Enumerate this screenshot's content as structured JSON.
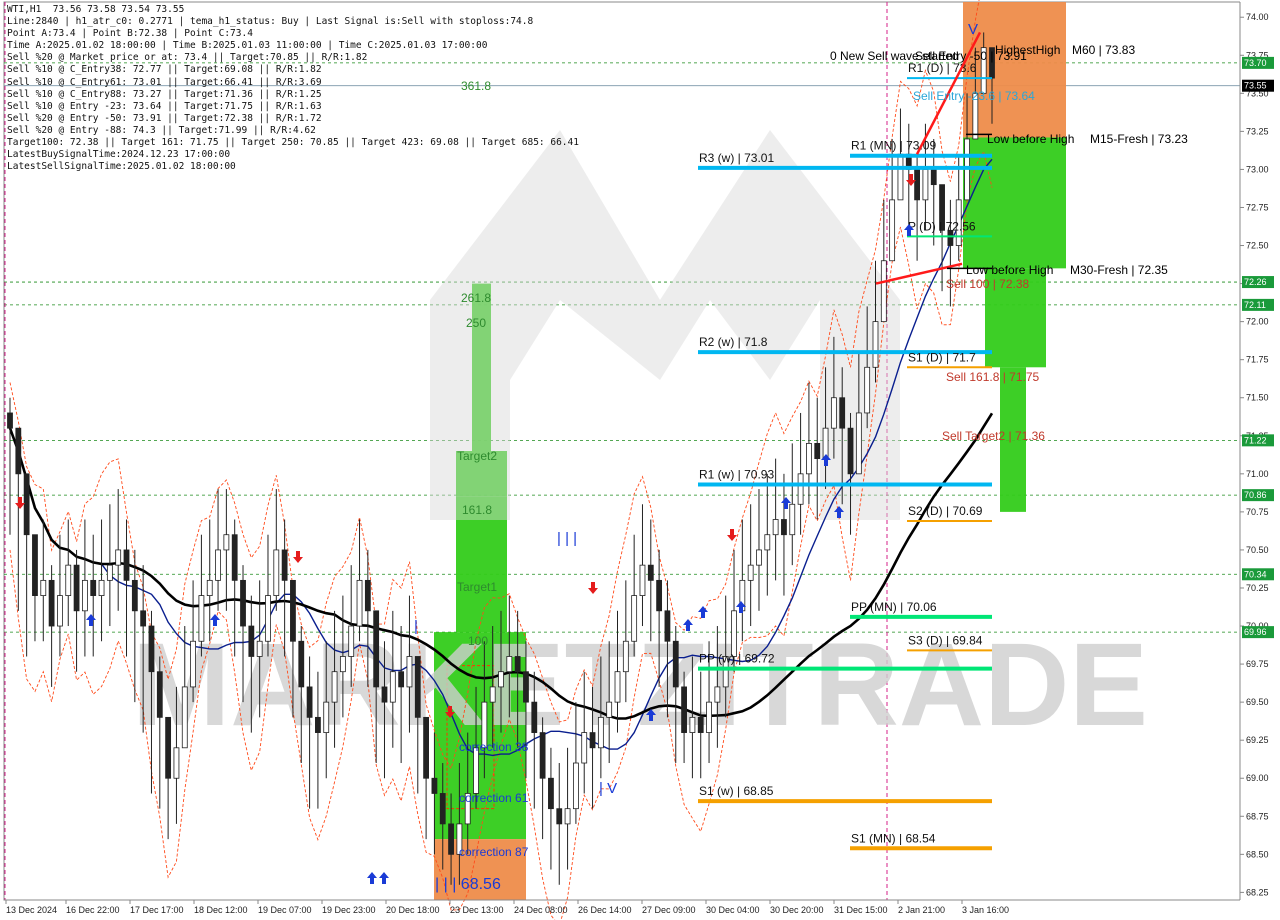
{
  "header": {
    "info_lines": [
      "WTI,H1  73.56 73.58 73.54 73.55",
      "Line:2840 | h1_atr_c0: 0.2771 | tema_h1_status: Buy | Last Signal is:Sell with stoploss:74.8",
      "Point A:73.4 | Point B:72.38 | Point C:73.4",
      "Time A:2025.01.02 18:00:00 | Time B:2025.01.03 11:00:00 | Time C:2025.01.03 17:00:00",
      "Sell %20 @ Market price or at: 73.4 || Target:70.85 || R/R:1.82",
      "Sell %10 @ C_Entry38: 72.77 || Target:69.08 || R/R:1.82",
      "Sell %10 @ C_Entry61: 73.01 || Target:66.41 || R/R:3.69",
      "Sell %10 @ C_Entry88: 73.27 || Target:71.36 || R/R:1.25",
      "Sell %10 @ Entry -23: 73.64 || Target:71.75 || R/R:1.63",
      "Sell %20 @ Entry -50: 73.91 || Target:72.38 || R/R:1.72",
      "Sell %20 @ Entry -88: 74.3 || Target:71.99 || R/R:4.62",
      "Target100: 72.38 || Target 161: 71.75 || Target 250: 70.85 || Target 423: 69.08 || Target 685: 66.41",
      "LatestBuySignalTime:2024.12.23 17:00:00",
      "LatestSellSignalTime:2025.01.02 18:00:00"
    ]
  },
  "watermark": "MARKETZITRADE",
  "colors": {
    "up": "#2e7d32",
    "down": "#8b1a1a",
    "candle_body_up": "#2e7d32",
    "ma_blue": "#0a1f8f",
    "ma_black": "#000000",
    "level_blue": "#00b7f1",
    "level_orange": "#f5a000",
    "level_green": "#00e676",
    "zone_green": "#33cc1a",
    "zone_orange": "#ee8c4a",
    "price_tag_green": "#1a9a3a",
    "grid_dash": "#1a8a1a"
  },
  "chart_data": {
    "type": "candlestick",
    "symbol": "WTI,H1",
    "ylim": [
      68.2,
      74.1
    ],
    "last_price": 73.55,
    "y_ticks": [
      74.0,
      73.75,
      73.5,
      73.25,
      73.0,
      72.75,
      72.5,
      72.25,
      72.0,
      71.75,
      71.5,
      71.25,
      71.0,
      70.75,
      70.5,
      70.25,
      70.0,
      69.75,
      69.5,
      69.25,
      69.0,
      68.75,
      68.5,
      68.25
    ],
    "y_tick_labels": [
      "74.00",
      "73.75",
      "73.50",
      "73.25",
      "73.00",
      "72.75",
      "72.50",
      "72.25",
      "72.00",
      "71.75",
      "71.50",
      "71.25",
      "71.00",
      "70.75",
      "70.50",
      "70.25",
      "70.00",
      "69.75",
      "69.50",
      "69.25",
      "69.00",
      "68.75",
      "68.50",
      "68.25"
    ],
    "highlighted_prices": [
      {
        "value": 73.7,
        "label": "73.70"
      },
      {
        "value": 72.26,
        "label": "72.26"
      },
      {
        "value": 72.11,
        "label": "72.11"
      },
      {
        "value": 71.22,
        "label": "71.22"
      },
      {
        "value": 70.86,
        "label": "70.86"
      },
      {
        "value": 70.34,
        "label": "70.34"
      },
      {
        "value": 69.96,
        "label": "69.96"
      }
    ],
    "x_labels": [
      "13 Dec 2024",
      "16 Dec 22:00",
      "17 Dec 17:00",
      "18 Dec 12:00",
      "19 Dec 07:00",
      "19 Dec 23:00",
      "20 Dec 18:00",
      "23 Dec 13:00",
      "24 Dec 08:00",
      "26 Dec 14:00",
      "27 Dec 09:00",
      "30 Dec 04:00",
      "30 Dec 20:00",
      "31 Dec 15:00",
      "2 Jan 21:00",
      "3 Jan 16:00"
    ],
    "closes": [
      71.3,
      71.0,
      70.6,
      70.2,
      70.3,
      70.0,
      70.2,
      70.4,
      70.1,
      70.3,
      70.2,
      70.3,
      70.4,
      70.5,
      70.3,
      70.1,
      70.0,
      69.7,
      69.4,
      69.0,
      69.2,
      69.6,
      69.9,
      70.2,
      70.3,
      70.5,
      70.6,
      70.3,
      70.0,
      69.8,
      69.9,
      70.2,
      70.5,
      70.3,
      69.9,
      69.6,
      69.4,
      69.3,
      69.5,
      69.7,
      69.8,
      70.0,
      70.3,
      70.1,
      69.6,
      69.5,
      69.7,
      69.6,
      69.8,
      69.4,
      69.0,
      68.9,
      68.7,
      68.5,
      68.7,
      68.9,
      69.2,
      69.5,
      69.6,
      69.7,
      69.8,
      69.7,
      69.5,
      69.3,
      69.0,
      68.8,
      68.7,
      68.8,
      69.1,
      69.3,
      69.2,
      69.4,
      69.5,
      69.7,
      69.9,
      70.2,
      70.4,
      70.3,
      70.1,
      69.9,
      69.6,
      69.3,
      69.4,
      69.3,
      69.5,
      69.6,
      69.8,
      70.1,
      70.3,
      70.4,
      70.5,
      70.6,
      70.7,
      70.6,
      70.8,
      71.0,
      71.2,
      71.1,
      71.3,
      71.5,
      71.3,
      71.0,
      71.4,
      71.7,
      72.0,
      72.4,
      72.8,
      73.1,
      73.0,
      72.8,
      73.0,
      72.9,
      72.6,
      72.5,
      72.8,
      73.2,
      73.5,
      73.8,
      73.6
    ],
    "lows": [
      70.6,
      70.1,
      69.8,
      69.9,
      69.9,
      69.6,
      69.8,
      70.0,
      69.7,
      69.8,
      69.8,
      69.9,
      70.0,
      70.1,
      69.8,
      69.5,
      69.3,
      68.9,
      68.8,
      68.6,
      68.7,
      69.2,
      69.5,
      69.8,
      69.9,
      70.1,
      70.1,
      69.8,
      69.5,
      69.3,
      69.4,
      69.8,
      70.1,
      69.8,
      69.4,
      69.1,
      68.8,
      68.8,
      69.0,
      69.2,
      69.4,
      69.6,
      69.9,
      69.6,
      69.1,
      69.0,
      69.2,
      69.1,
      69.3,
      68.9,
      68.6,
      68.5,
      68.4,
      68.3,
      68.3,
      68.5,
      68.8,
      69.0,
      69.2,
      69.3,
      69.4,
      69.2,
      69.0,
      68.8,
      68.6,
      68.4,
      68.3,
      68.4,
      68.7,
      68.9,
      68.8,
      69.0,
      69.1,
      69.3,
      69.5,
      69.8,
      70.0,
      69.9,
      69.6,
      69.4,
      69.1,
      69.1,
      69.0,
      69.0,
      69.1,
      69.2,
      69.4,
      69.7,
      69.9,
      70.0,
      70.1,
      70.2,
      70.3,
      70.2,
      70.4,
      70.6,
      70.8,
      70.7,
      70.9,
      71.1,
      70.8,
      70.6,
      71.0,
      71.3,
      71.6,
      72.0,
      72.4,
      72.8,
      72.6,
      72.4,
      72.6,
      72.5,
      72.2,
      72.1,
      72.4,
      72.9,
      73.2,
      73.5,
      73.3
    ],
    "highs": [
      71.5,
      71.3,
      70.9,
      70.6,
      70.7,
      70.4,
      70.6,
      70.7,
      70.5,
      70.7,
      70.6,
      70.7,
      70.8,
      70.9,
      70.7,
      70.5,
      70.4,
      70.1,
      69.8,
      69.4,
      69.6,
      70.0,
      70.3,
      70.6,
      70.7,
      70.9,
      70.9,
      70.7,
      70.4,
      70.2,
      70.3,
      70.6,
      70.9,
      70.7,
      70.3,
      70.0,
      69.8,
      69.7,
      69.9,
      70.1,
      70.2,
      70.4,
      70.7,
      70.5,
      70.0,
      69.9,
      70.1,
      70.0,
      70.2,
      69.8,
      69.4,
      69.3,
      69.1,
      68.9,
      69.1,
      69.3,
      69.6,
      69.9,
      70.0,
      70.1,
      70.2,
      70.1,
      69.9,
      69.7,
      69.4,
      69.2,
      69.1,
      69.2,
      69.5,
      69.7,
      69.6,
      69.8,
      69.9,
      70.1,
      70.3,
      70.6,
      70.8,
      70.7,
      70.5,
      70.3,
      70.0,
      69.7,
      69.8,
      69.7,
      69.9,
      70.0,
      70.2,
      70.5,
      70.7,
      70.8,
      70.9,
      71.0,
      71.1,
      71.0,
      71.2,
      71.4,
      71.6,
      71.5,
      71.7,
      71.9,
      71.7,
      71.4,
      71.8,
      72.1,
      72.4,
      72.8,
      73.2,
      73.4,
      73.3,
      73.1,
      73.3,
      73.2,
      72.9,
      72.8,
      73.1,
      73.5,
      73.8,
      73.9,
      73.8
    ],
    "levels": [
      {
        "label": "R3 (w) | 73.01",
        "value": 73.01,
        "color": "#00b7f1"
      },
      {
        "label": "R2 (w) | 71.8",
        "value": 71.8,
        "color": "#00b7f1"
      },
      {
        "label": "R1 (w) | 70.93",
        "value": 70.93,
        "color": "#00b7f1"
      },
      {
        "label": "PP (w) | 69.72",
        "value": 69.72,
        "color": "#00e676"
      },
      {
        "label": "S1 (w) | 68.85",
        "value": 68.85,
        "color": "#f5a000"
      },
      {
        "label": "PP (MN) | 70.06",
        "value": 70.06,
        "color": "#00e676"
      },
      {
        "label": "S1 (MN) | 68.54",
        "value": 68.54,
        "color": "#f5a000"
      },
      {
        "label": "R1 (MN) | 73.09",
        "value": 73.09,
        "color": "#00b7f1"
      },
      {
        "label": "R1 (D) | 73.6",
        "value": 73.6,
        "color": "#00b7f1"
      },
      {
        "label": "P (D) | 72.56",
        "value": 72.56,
        "color": "#00e676"
      },
      {
        "label": "S1 (D) | 71.7",
        "value": 71.7,
        "color": "#f5a000"
      },
      {
        "label": "S2 (D) | 70.69",
        "value": 70.69,
        "color": "#f5a000"
      },
      {
        "label": "S3 (D) | 69.84",
        "value": 69.84,
        "color": "#f5a000"
      }
    ],
    "annotations": [
      {
        "text": "0 New Sell wave started",
        "color": "#000000"
      },
      {
        "text": "Sell Entry -50 | 73.91",
        "color": "#000000"
      },
      {
        "text": "HighestHigh",
        "color": "#000000"
      },
      {
        "text": "M60 | 73.83",
        "color": "#000000"
      },
      {
        "text": "Sell Entry -23.6 | 73.64",
        "color": "#2aa6d8"
      },
      {
        "text": "Low before High",
        "color": "#000000"
      },
      {
        "text": "M15-Fresh | 73.23",
        "color": "#000000"
      },
      {
        "text": "M30-Fresh | 72.35",
        "color": "#000000"
      },
      {
        "text": "Sell 100 | 72.38",
        "color": "#c0392b"
      },
      {
        "text": "Sell 161.8 | 71.75",
        "color": "#c0392b"
      },
      {
        "text": "Sell Target2 | 71.36",
        "color": "#c0392b"
      },
      {
        "text": "361.8",
        "color": "#2e8b2e"
      },
      {
        "text": "261.8",
        "color": "#2e8b2e"
      },
      {
        "text": "250",
        "color": "#2e8b2e"
      },
      {
        "text": "Target2",
        "color": "#2e8b2e"
      },
      {
        "text": "161.8",
        "color": "#2e8b2e"
      },
      {
        "text": "Target1",
        "color": "#2e8b2e"
      },
      {
        "text": "100",
        "color": "#2e8b2e"
      },
      {
        "text": "correction 38",
        "color": "#1a3bd6"
      },
      {
        "text": "correction 61",
        "color": "#1a3bd6"
      },
      {
        "text": "correction 87",
        "color": "#1a3bd6"
      },
      {
        "text": "| | | 68.56",
        "color": "#1a3bd6"
      },
      {
        "text": "| | |",
        "color": "#1a3bd6"
      },
      {
        "text": "| V",
        "color": "#1a3bd6"
      },
      {
        "text": "|",
        "color": "#1a3bd6"
      },
      {
        "text": "V",
        "color": "#1a3bd6"
      }
    ]
  }
}
